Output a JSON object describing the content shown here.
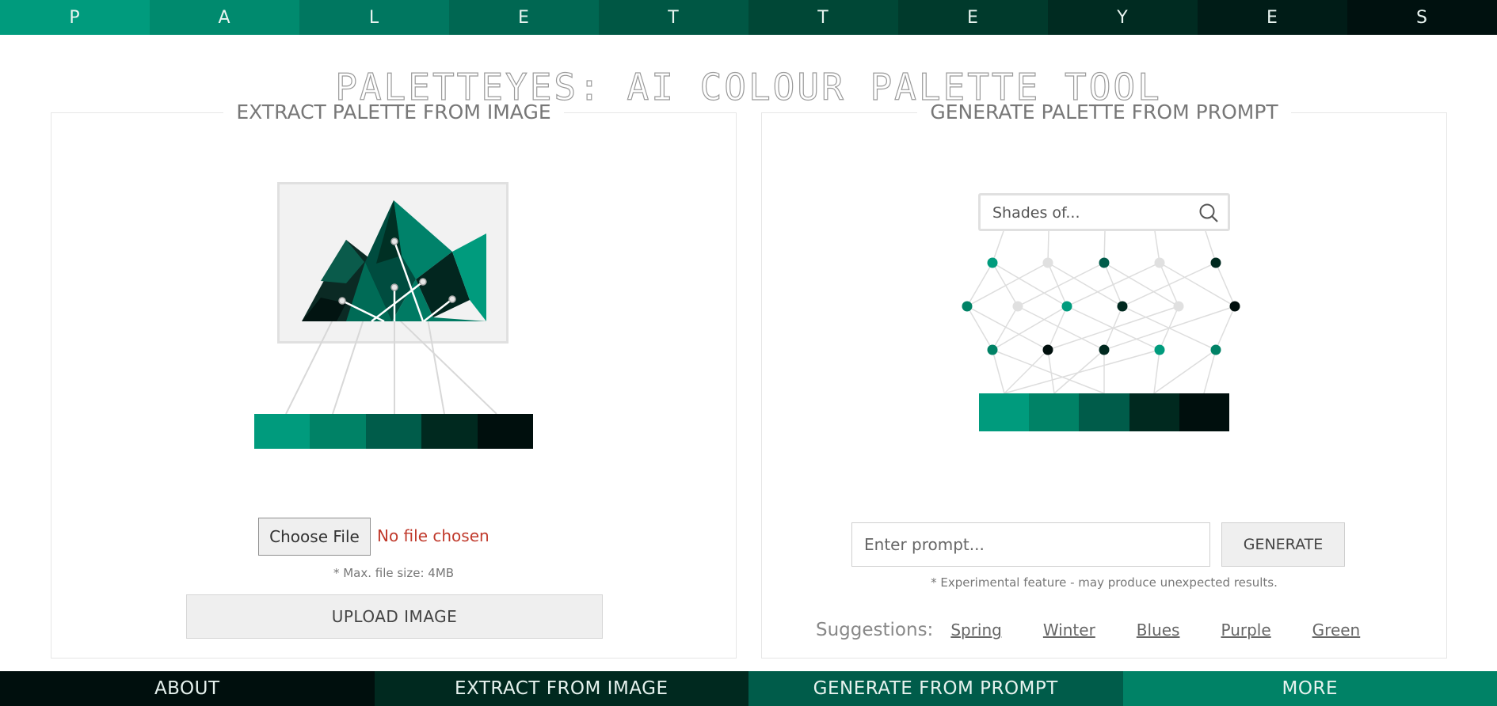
{
  "banner": {
    "letters": [
      "P",
      "A",
      "L",
      "E",
      "T",
      "T",
      "E",
      "Y",
      "E",
      "S"
    ],
    "colors": [
      "#009b7d",
      "#008a6e",
      "#007760",
      "#006752",
      "#005744",
      "#004736",
      "#003a2c",
      "#002b21",
      "#001c17",
      "#00110f"
    ]
  },
  "page": {
    "title": "PALETTEYES: AI COLOUR PALETTE TOOL"
  },
  "extract": {
    "heading": "EXTRACT PALETTE FROM IMAGE",
    "swatches": [
      "#009b7d",
      "#008266",
      "#005c4a",
      "#00291f",
      "#000f0d"
    ],
    "choose_file_label": "Choose File",
    "file_status": "No file chosen",
    "size_hint": "* Max. file size: 4MB",
    "upload_label": "UPLOAD IMAGE"
  },
  "generate": {
    "heading": "GENERATE PALETTE FROM PROMPT",
    "search_text": "Shades of...",
    "swatches": [
      "#009b7d",
      "#008266",
      "#005c4a",
      "#00291f",
      "#000f0d"
    ],
    "prompt_placeholder": "Enter prompt...",
    "generate_label": "GENERATE",
    "hint": "* Experimental feature - may produce unexpected results.",
    "suggestions_label": "Suggestions:",
    "suggestions": [
      "Spring",
      "Winter",
      "Blues",
      "Purple",
      "Green"
    ]
  },
  "nav": {
    "items": [
      "ABOUT",
      "EXTRACT FROM IMAGE",
      "GENERATE FROM PROMPT",
      "MORE"
    ],
    "colors": [
      "#000f0d",
      "#00291f",
      "#005c4a",
      "#008266"
    ]
  },
  "icons": {
    "search": "search-icon"
  }
}
